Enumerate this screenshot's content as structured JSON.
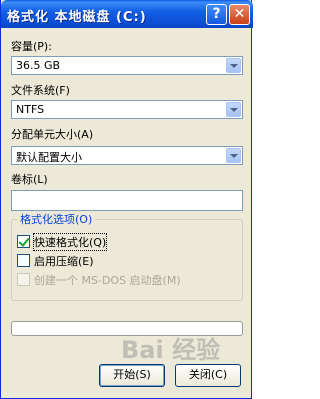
{
  "window": {
    "title": "格式化 本地磁盘 (C:)",
    "help_label": "?",
    "close_label": "✕"
  },
  "capacity": {
    "label": "容量(P):",
    "value": "36.5 GB"
  },
  "filesystem": {
    "label": "文件系统(F)",
    "value": "NTFS"
  },
  "alloc_unit": {
    "label": "分配单元大小(A)",
    "value": "默认配置大小"
  },
  "volume_label": {
    "label": "卷标(L)",
    "value": ""
  },
  "format_options": {
    "title": "格式化选项(O)",
    "quick_format": {
      "label": "快速格式化(Q)",
      "checked": true
    },
    "compression": {
      "label": "启用压缩(E)",
      "checked": false
    },
    "msdos_disk": {
      "label": "创建一个 MS-DOS 启动盘(M)",
      "checked": false,
      "disabled": true
    }
  },
  "progress": {
    "value": 0
  },
  "buttons": {
    "start": "开始(S)",
    "close": "关闭(C)"
  },
  "watermark": "Bai 经验"
}
